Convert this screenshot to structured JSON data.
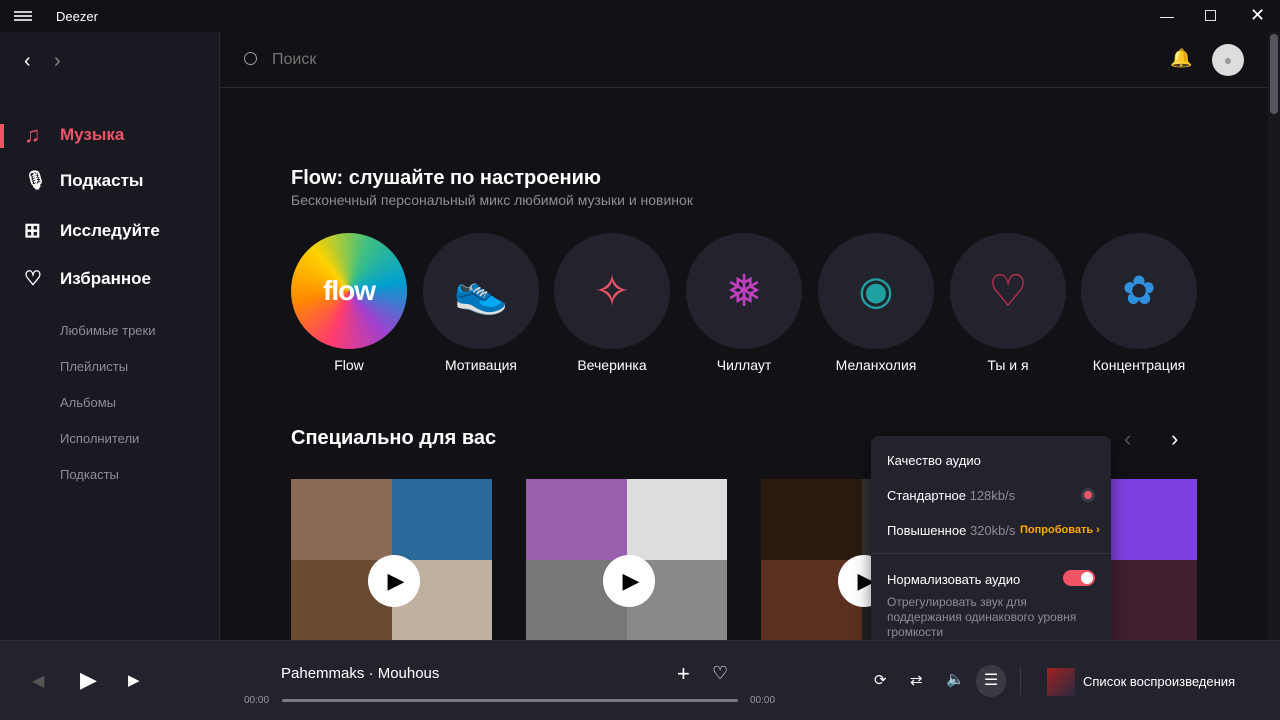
{
  "app": {
    "title": "Deezer"
  },
  "sidebar": {
    "items": [
      {
        "label": "Музыка"
      },
      {
        "label": "Подкасты"
      },
      {
        "label": "Исследуйте"
      },
      {
        "label": "Избранное"
      }
    ],
    "sub_items": [
      "Любимые треки",
      "Плейлисты",
      "Альбомы",
      "Исполнители",
      "Подкасты"
    ]
  },
  "search": {
    "placeholder": "Поиск"
  },
  "flow": {
    "title": "Flow: слушайте по настроению",
    "subtitle": "Бесконечный персональный микс любимой музыки и новинок",
    "logo_text": "flow",
    "moods": [
      "Flow",
      "Мотивация",
      "Вечеринка",
      "Чиллаут",
      "Меланхолия",
      "Ты и я",
      "Концентрация"
    ]
  },
  "special": {
    "title": "Специально для вас"
  },
  "audio_popup": {
    "title": "Качество аудио",
    "standard": "Стандартное",
    "standard_rate": "128kb/s",
    "high": "Повышенное",
    "high_rate": "320kb/s",
    "try": "Попробовать",
    "normalize": "Нормализовать аудио",
    "normalize_on": true,
    "normalize_desc": "Отрегулировать звук для поддержания одинакового уровня громкости"
  },
  "player": {
    "track": "Pahemmaks · Mouhous",
    "time_current": "00:00",
    "time_total": "00:00",
    "progress": 0,
    "queue_label": "Список воспроизведения"
  },
  "colors": {
    "accent": "#ef5466",
    "try": "#ffa800"
  }
}
